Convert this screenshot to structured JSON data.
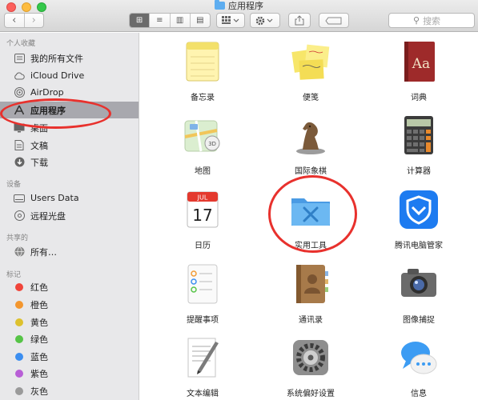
{
  "window": {
    "title": "应用程序"
  },
  "toolbar": {
    "back_glyph": "‹",
    "forward_glyph": "›",
    "view_icons": [
      "⊞",
      "≡",
      "▥",
      "▤"
    ],
    "search_placeholder": "搜索",
    "search_icon": "magnifier-icon"
  },
  "sidebar": {
    "sections": {
      "favorites": "个人收藏",
      "devices": "设备",
      "shared": "共享的",
      "tags": "标记"
    },
    "favorites": [
      {
        "label": "我的所有文件",
        "icon": "all-files-icon"
      },
      {
        "label": "iCloud Drive",
        "icon": "cloud-icon"
      },
      {
        "label": "AirDrop",
        "icon": "airdrop-icon"
      },
      {
        "label": "应用程序",
        "icon": "applications-icon",
        "selected": true
      },
      {
        "label": "桌面",
        "icon": "desktop-icon"
      },
      {
        "label": "文稿",
        "icon": "documents-icon"
      },
      {
        "label": "下载",
        "icon": "downloads-icon"
      }
    ],
    "devices": [
      {
        "label": "Users Data",
        "icon": "drive-icon"
      },
      {
        "label": "远程光盘",
        "icon": "disc-icon"
      }
    ],
    "shared": [
      {
        "label": "所有…",
        "icon": "network-icon"
      }
    ],
    "tags": [
      {
        "label": "红色",
        "color": "#f0443a"
      },
      {
        "label": "橙色",
        "color": "#f3962e"
      },
      {
        "label": "黄色",
        "color": "#ddc12e"
      },
      {
        "label": "绿色",
        "color": "#56c447"
      },
      {
        "label": "蓝色",
        "color": "#3c8ef0"
      },
      {
        "label": "紫色",
        "color": "#b85fd6"
      },
      {
        "label": "灰色",
        "color": "#9a9a9a"
      }
    ]
  },
  "apps": [
    {
      "label": "备忘录"
    },
    {
      "label": "便笺"
    },
    {
      "label": "词典"
    },
    {
      "label": "地图"
    },
    {
      "label": "国际象棋"
    },
    {
      "label": "计算器"
    },
    {
      "label": "日历",
      "month": "JUL",
      "day": "17"
    },
    {
      "label": "实用工具"
    },
    {
      "label": "腾讯电脑管家"
    },
    {
      "label": "提醒事项"
    },
    {
      "label": "通讯录"
    },
    {
      "label": "图像捕捉"
    },
    {
      "label": "文本编辑"
    },
    {
      "label": "系统偏好设置"
    },
    {
      "label": "信息"
    }
  ],
  "colors": {
    "highlight_circle": "#e8312d",
    "folder_blue": "#5dadf0",
    "tencent_blue": "#1d7bf0"
  }
}
